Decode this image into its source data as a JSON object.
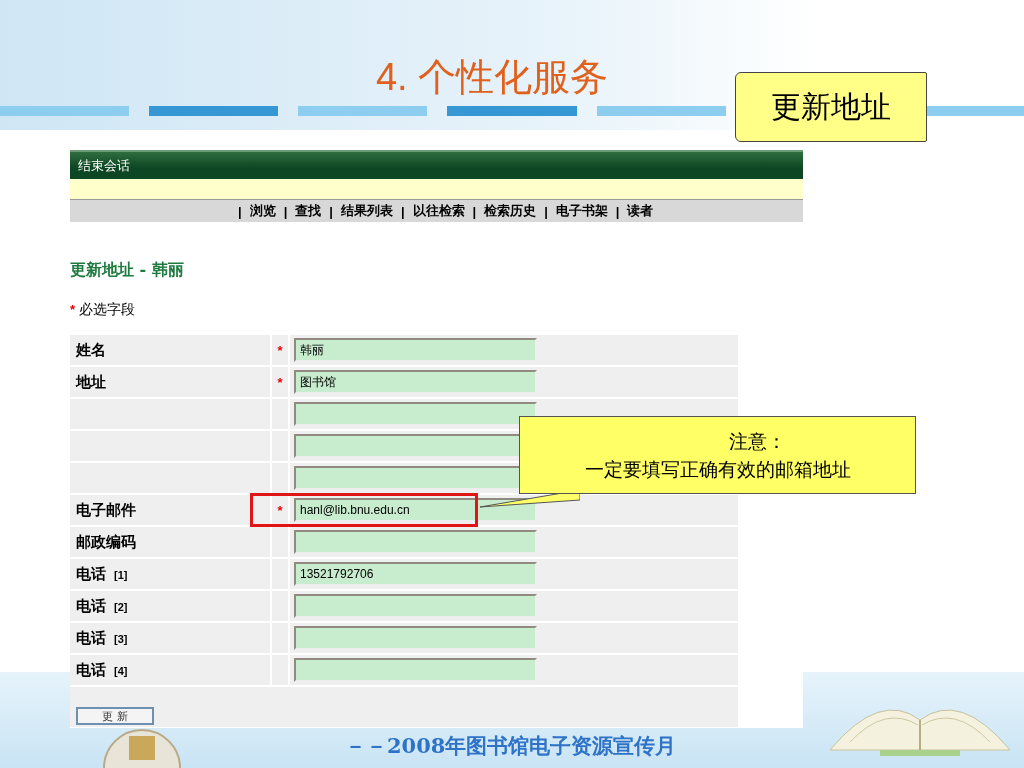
{
  "slide": {
    "title": "4. 个性化服务",
    "scroll_banner": "更新地址",
    "footer": "－－2008年图书馆电子资源宣传月"
  },
  "screenshot": {
    "top_bar": {
      "link": "结束会话"
    },
    "nav": {
      "separator": "|",
      "items": [
        "浏览",
        "查找",
        "结果列表",
        "以往检索",
        "检索历史",
        "电子书架",
        "读者"
      ]
    },
    "heading": "更新地址  - 韩丽",
    "required_note": {
      "mark": "*",
      "text": "必选字段"
    },
    "fields": [
      {
        "label": "姓名",
        "required": true,
        "value": "韩丽",
        "highlighted": false
      },
      {
        "label": "地址",
        "required": true,
        "value": "图书馆",
        "highlighted": false
      },
      {
        "required": false,
        "highlighted": false
      },
      {
        "required": false,
        "highlighted": false
      },
      {
        "required": false,
        "highlighted": false
      },
      {
        "label": "电子邮件",
        "required": true,
        "value": "hanl@lib.bnu.edu.cn",
        "highlighted": true
      },
      {
        "label": "邮政编码",
        "required": false,
        "highlighted": false
      },
      {
        "label": "电话",
        "index": "[1]",
        "required": false,
        "value": "13521792706",
        "highlighted": false
      },
      {
        "label": "电话",
        "index": "[2]",
        "required": false,
        "highlighted": false
      },
      {
        "label": "电话",
        "index": "[3]",
        "required": false,
        "highlighted": false
      },
      {
        "label": "电话",
        "index": "[4]",
        "required": false,
        "highlighted": false
      }
    ],
    "submit_button": "更 新"
  },
  "callout": {
    "lines": [
      "注意：",
      "一定要填写正确有效的邮箱地址"
    ]
  }
}
